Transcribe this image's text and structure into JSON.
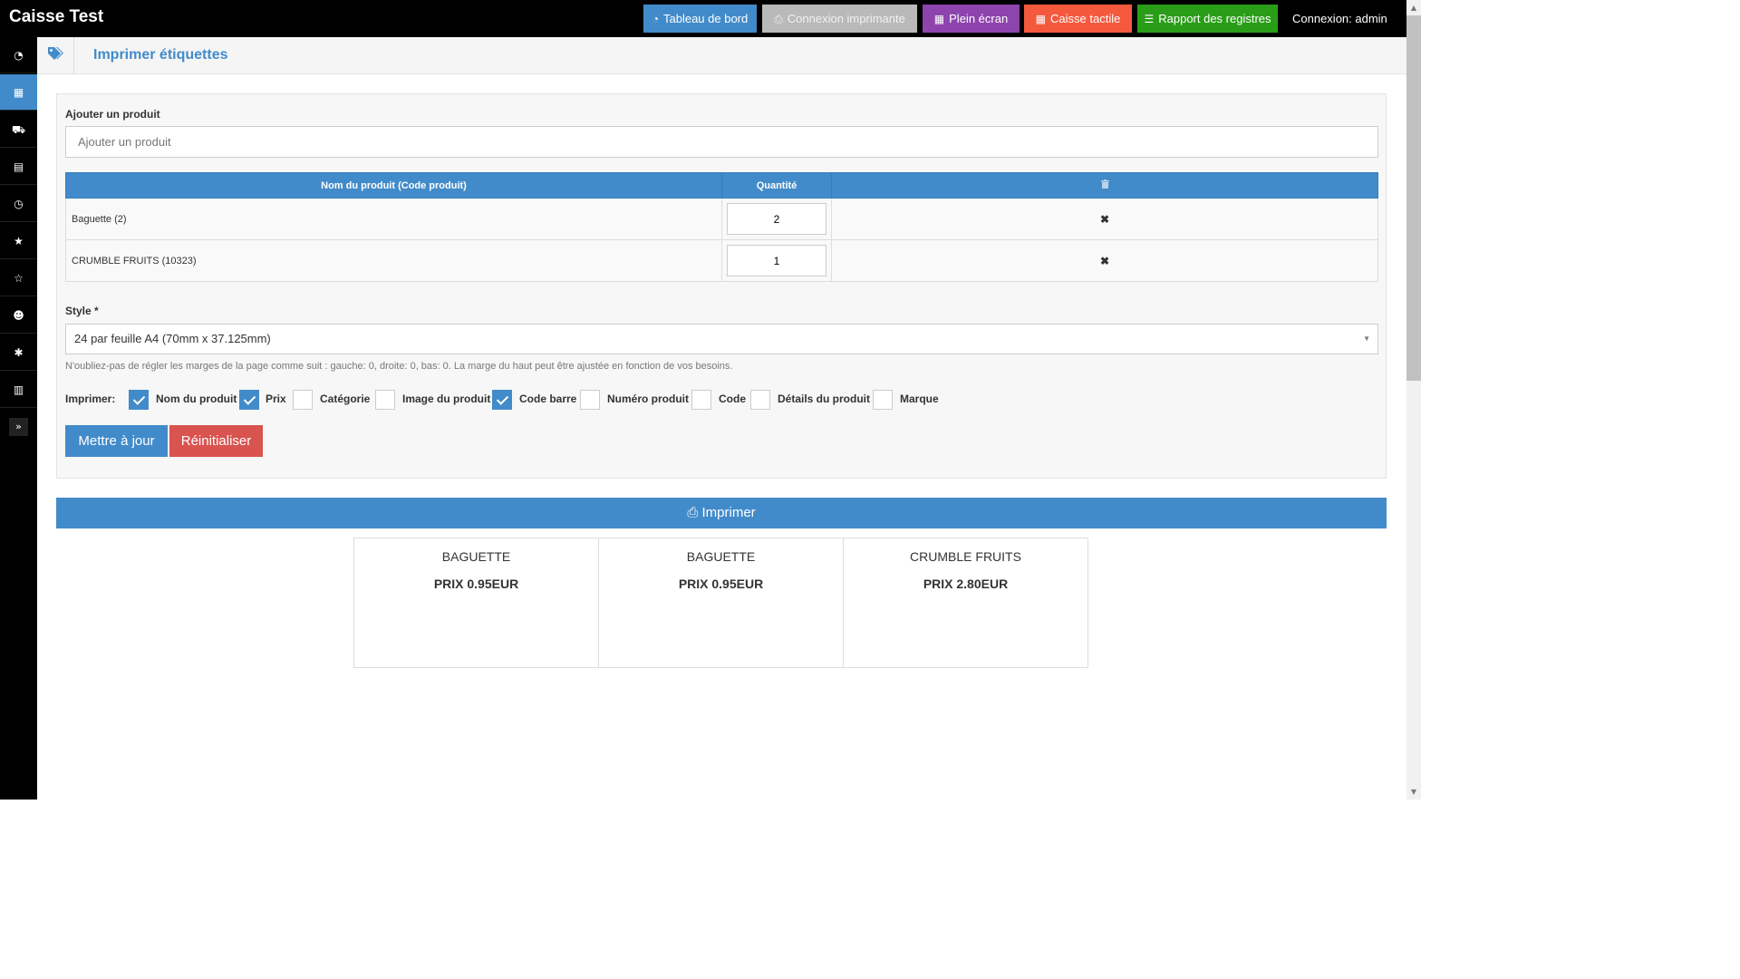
{
  "app": {
    "title": "Caisse Test",
    "login": "Connexion: admin"
  },
  "topbar": {
    "buttons": [
      {
        "label": "Tableau de bord",
        "icon": "dashboard-icon",
        "color": "#428bca"
      },
      {
        "label": "Connexion imprimante",
        "icon": "printer-icon",
        "color": "#b9b9b9"
      },
      {
        "label": "Plein écran",
        "icon": "fullscreen-icon",
        "color": "#8e44ad"
      },
      {
        "label": "Caisse tactile",
        "icon": "touch-register-icon",
        "color": "#f5593d"
      },
      {
        "label": "Rapport des registres",
        "icon": "list-icon",
        "color": "#2a9d18"
      }
    ]
  },
  "sidebar": {
    "items": [
      {
        "icon": "dashboard-icon",
        "glyph": "◔"
      },
      {
        "icon": "barcode-icon",
        "glyph": "▦",
        "active": true
      },
      {
        "icon": "cart-icon",
        "glyph": "⛟"
      },
      {
        "icon": "document-icon",
        "glyph": "▤"
      },
      {
        "icon": "clock-icon",
        "glyph": "◷"
      },
      {
        "icon": "star-icon",
        "glyph": "★"
      },
      {
        "icon": "star-outline-icon",
        "glyph": "☆"
      },
      {
        "icon": "users-icon",
        "glyph": "☻"
      },
      {
        "icon": "gear-icon",
        "glyph": "✱"
      },
      {
        "icon": "chart-icon",
        "glyph": "▥"
      }
    ],
    "toggle_glyph": "»"
  },
  "page": {
    "title": "Imprimer étiquettes",
    "icon": "tags-icon"
  },
  "form": {
    "add_product_label": "Ajouter un produit",
    "add_product_placeholder": "Ajouter un produit",
    "table": {
      "headers": {
        "name": "Nom du produit (Code produit)",
        "qty": "Quantité",
        "delete_icon": "trash-icon"
      },
      "rows": [
        {
          "name": "Baguette (2)",
          "qty": "2"
        },
        {
          "name": "CRUMBLE FRUITS (10323)",
          "qty": "1"
        }
      ],
      "remove_glyph": "✖"
    },
    "style_label": "Style *",
    "style_value": "24 par feuille A4 (70mm x 37.125mm)",
    "hint": "N'oubliez-pas de régler les marges de la page comme suit : gauche: 0, droite: 0, bas: 0. La marge du haut peut être ajustée en fonction de vos besoins.",
    "print_label": "Imprimer:",
    "options": [
      {
        "label": "Nom du produit",
        "checked": true
      },
      {
        "label": "Prix",
        "checked": true
      },
      {
        "label": "Catégorie",
        "checked": false
      },
      {
        "label": "Image du produit",
        "checked": false
      },
      {
        "label": "Code barre",
        "checked": true
      },
      {
        "label": "Numéro produit",
        "checked": false
      },
      {
        "label": "Code",
        "checked": false
      },
      {
        "label": "Détails du produit",
        "checked": false
      },
      {
        "label": "Marque",
        "checked": false
      }
    ],
    "update_button": "Mettre à jour",
    "reset_button": "Réinitialiser"
  },
  "print_button": "Imprimer",
  "labels": [
    {
      "name": "BAGUETTE",
      "price": "PRIX 0.95EUR"
    },
    {
      "name": "BAGUETTE",
      "price": "PRIX 0.95EUR"
    },
    {
      "name": "CRUMBLE FRUITS",
      "price": "PRIX 2.80EUR"
    }
  ]
}
